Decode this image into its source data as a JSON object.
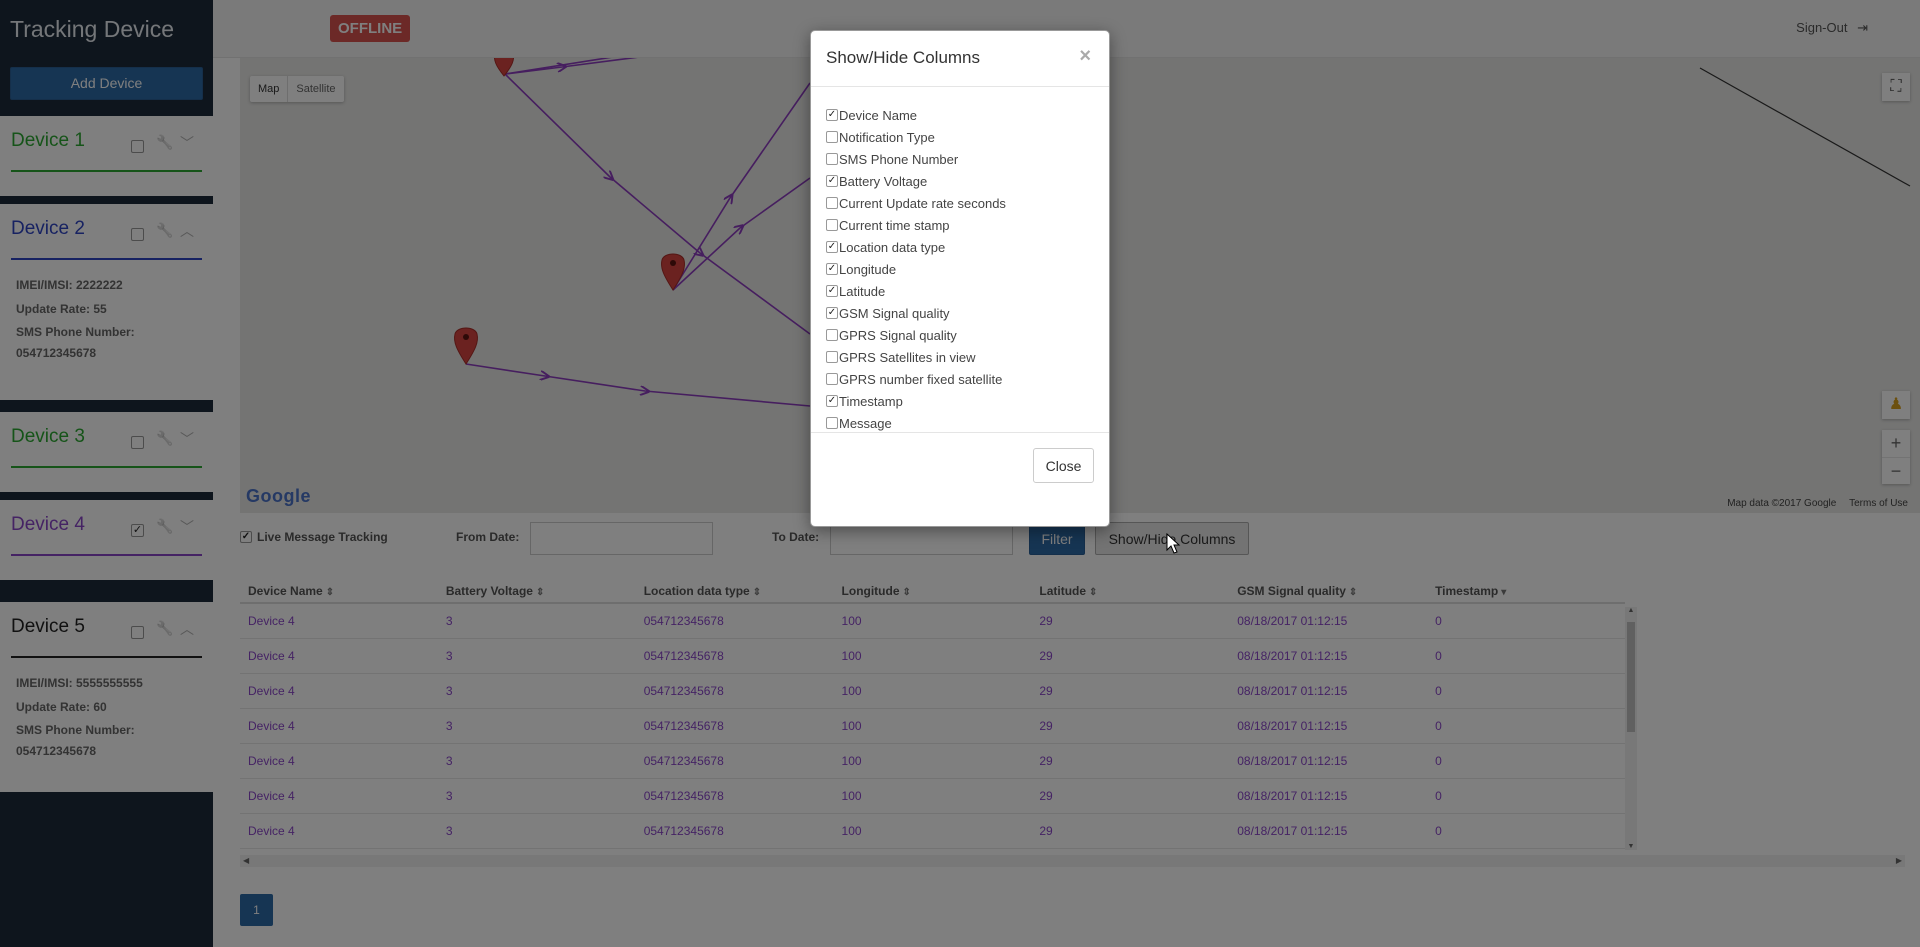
{
  "app": {
    "title": "Tracking Device",
    "add_device_label": "Add Device",
    "status_badge": "OFFLINE",
    "signout_label": "Sign-Out"
  },
  "colors": {
    "sidebar_bg": "#1c2b3a",
    "accent_blue": "#2d6aa6",
    "offline_red": "#d9534f",
    "row_text_purple": "#8b46c9",
    "route_purple": "#8d3cbf"
  },
  "devices": [
    {
      "name": "Device 1",
      "color": "#2ca832",
      "checked": false,
      "expanded": false
    },
    {
      "name": "Device 2",
      "color": "#2f45c4",
      "checked": false,
      "expanded": true,
      "imei": "IMEI/IMSI: 2222222",
      "update_rate": "Update Rate: 55",
      "sms_label": "SMS Phone Number:",
      "sms_value": "054712345678"
    },
    {
      "name": "Device 3",
      "color": "#2ca832",
      "checked": false,
      "expanded": false
    },
    {
      "name": "Device 4",
      "color": "#8b46c9",
      "checked": true,
      "expanded": false
    },
    {
      "name": "Device 5",
      "color": "#222222",
      "checked": false,
      "expanded": true,
      "imei": "IMEI/IMSI: 5555555555",
      "update_rate": "Update Rate: 60",
      "sms_label": "SMS Phone Number:",
      "sms_value": "054712345678"
    }
  ],
  "map": {
    "type_map": "Map",
    "type_satellite": "Satellite",
    "google_logo": "Google",
    "map_data": "Map data ©2017 Google",
    "terms": "Terms of Use",
    "zoom_in": "+",
    "zoom_out": "−"
  },
  "filters": {
    "live_tracking_label": "Live Message Tracking",
    "live_tracking_checked": true,
    "from_date_label": "From Date:",
    "to_date_label": "To Date:",
    "from_date_value": "",
    "to_date_value": "",
    "filter_button": "Filter",
    "columns_button": "Show/Hide Columns"
  },
  "table": {
    "columns": [
      "Device Name",
      "Battery Voltage",
      "Location data type",
      "Longitude",
      "Latitude",
      "GSM Signal quality",
      "Timestamp"
    ],
    "rows": [
      [
        "Device 4",
        "3",
        "054712345678",
        "100",
        "29",
        "08/18/2017 01:12:15",
        "0"
      ],
      [
        "Device 4",
        "3",
        "054712345678",
        "100",
        "29",
        "08/18/2017 01:12:15",
        "0"
      ],
      [
        "Device 4",
        "3",
        "054712345678",
        "100",
        "29",
        "08/18/2017 01:12:15",
        "0"
      ],
      [
        "Device 4",
        "3",
        "054712345678",
        "100",
        "29",
        "08/18/2017 01:12:15",
        "0"
      ],
      [
        "Device 4",
        "3",
        "054712345678",
        "100",
        "29",
        "08/18/2017 01:12:15",
        "0"
      ],
      [
        "Device 4",
        "3",
        "054712345678",
        "100",
        "29",
        "08/18/2017 01:12:15",
        "0"
      ],
      [
        "Device 4",
        "3",
        "054712345678",
        "100",
        "29",
        "08/18/2017 01:12:15",
        "0"
      ]
    ]
  },
  "pagination": {
    "current_page": "1"
  },
  "modal": {
    "title": "Show/Hide Columns",
    "close_x": "×",
    "close_button": "Close",
    "options": [
      {
        "label": "Device Name",
        "checked": true
      },
      {
        "label": "Notification Type",
        "checked": false
      },
      {
        "label": "SMS Phone Number",
        "checked": false
      },
      {
        "label": "Battery Voltage",
        "checked": true
      },
      {
        "label": "Current Update rate seconds",
        "checked": false
      },
      {
        "label": "Current time stamp",
        "checked": false
      },
      {
        "label": "Location data type",
        "checked": true
      },
      {
        "label": "Longitude",
        "checked": true
      },
      {
        "label": "Latitude",
        "checked": true
      },
      {
        "label": "GSM Signal quality",
        "checked": true
      },
      {
        "label": "GPRS Signal quality",
        "checked": false
      },
      {
        "label": "GPRS Satellites in view",
        "checked": false
      },
      {
        "label": "GPRS number fixed satellite",
        "checked": false
      },
      {
        "label": "Timestamp",
        "checked": true
      },
      {
        "label": "Message",
        "checked": false
      }
    ]
  }
}
